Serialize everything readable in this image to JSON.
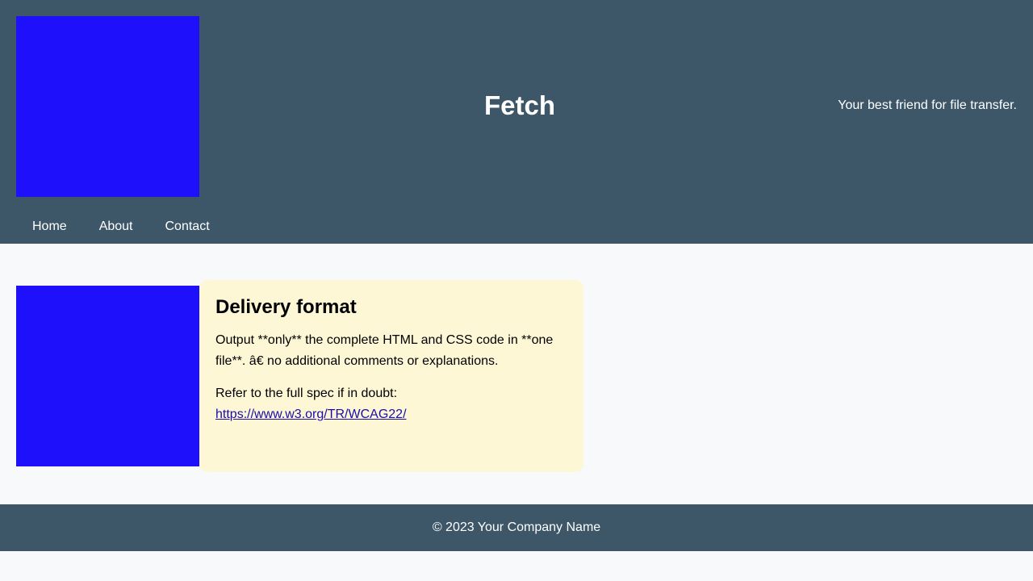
{
  "header": {
    "title": "Fetch",
    "tagline": "Your best friend for file transfer.",
    "logo_color": "#1f10fb",
    "background": "#3d5769"
  },
  "nav": {
    "items": [
      {
        "label": "Home"
      },
      {
        "label": "About"
      },
      {
        "label": "Contact"
      }
    ]
  },
  "main": {
    "image_color": "#1f10fb",
    "card": {
      "title": "Delivery format",
      "paragraph": "Output **only** the complete HTML and CSS code in **one file**. â€    no additional comments or explanations.",
      "ref_prefix": "Refer to the full spec if in doubt:",
      "link_text": "https://www.w3.org/TR/WCAG22/",
      "background": "#fef7d6"
    }
  },
  "footer": {
    "text": "© 2023 Your Company Name"
  }
}
